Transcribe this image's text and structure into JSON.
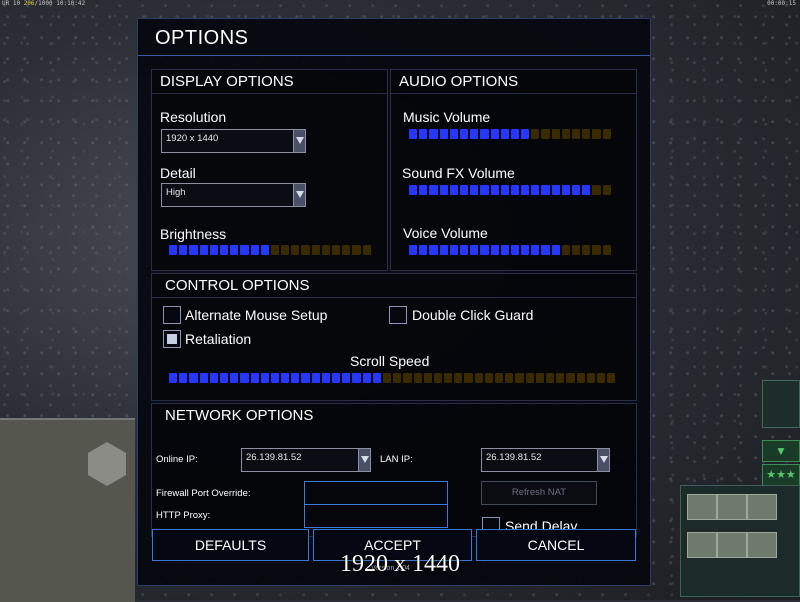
{
  "hud": {
    "top_left": "10:10:42",
    "top_left_counts": "UR 10",
    "top_left_highlight": "206",
    "top_left_tail": "1000",
    "top_right": "00:00:15"
  },
  "dialog": {
    "title": "OPTIONS",
    "display": {
      "title": "DISPLAY OPTIONS",
      "resolution_label": "Resolution",
      "resolution_value": "1920 x 1440",
      "detail_label": "Detail",
      "detail_value": "High",
      "brightness_label": "Brightness",
      "brightness_level": 0.5
    },
    "audio": {
      "title": "AUDIO OPTIONS",
      "music_label": "Music Volume",
      "music_level": 0.6,
      "sfx_label": "Sound FX Volume",
      "sfx_level": 0.875,
      "voice_label": "Voice Volume",
      "voice_level": 0.75
    },
    "control": {
      "title": "CONTROL OPTIONS",
      "alt_mouse_label": "Alternate Mouse Setup",
      "alt_mouse_checked": false,
      "double_click_label": "Double Click Guard",
      "double_click_checked": false,
      "retaliation_label": "Retaliation",
      "retaliation_checked": true,
      "scroll_label": "Scroll Speed",
      "scroll_level": 0.48
    },
    "network": {
      "title": "NETWORK OPTIONS",
      "online_ip_label": "Online IP:",
      "online_ip_value": "26.139.81.52",
      "lan_ip_label": "LAN IP:",
      "lan_ip_value": "26.139.81.52",
      "firewall_label": "Firewall Port Override:",
      "firewall_value": "",
      "proxy_label": "HTTP Proxy:",
      "proxy_value": "",
      "refresh_nat_label": "Refresh NAT",
      "send_delay_label": "Send Delay",
      "send_delay_checked": false
    },
    "buttons": {
      "defaults": "DEFAULTS",
      "accept": "ACCEPT",
      "cancel": "CANCEL"
    },
    "version": "Version 1.04"
  },
  "overlay_text": "1920 x 1440",
  "colors": {
    "slider_on": "#2438ff",
    "slider_off": "#3a2a00",
    "accent_border": "#3a78d8"
  }
}
